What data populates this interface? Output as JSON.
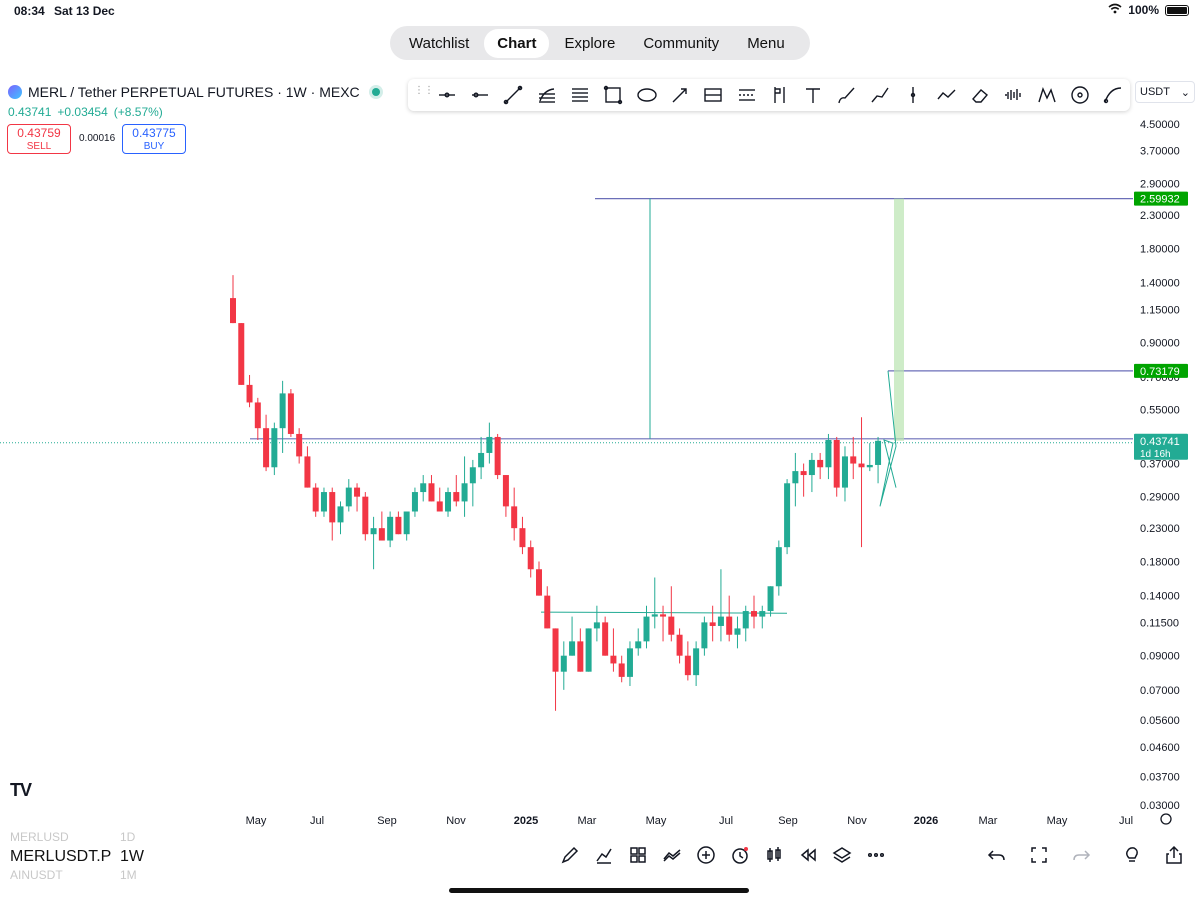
{
  "status_bar": {
    "time": "08:34",
    "date": "Sat 13 Dec",
    "battery": "100%"
  },
  "nav": {
    "items": [
      "Watchlist",
      "Chart",
      "Explore",
      "Community",
      "Menu"
    ],
    "active": "Chart"
  },
  "symbol": {
    "title": "MERL / Tether PERPETUAL FUTURES · 1W · MEXC",
    "last": "0.43741",
    "change": "+0.03454",
    "change_pct": "(+8.57%)",
    "sell_price": "0.43759",
    "sell_label": "SELL",
    "spread": "0.00016",
    "buy_price": "0.43775",
    "buy_label": "BUY"
  },
  "toolbar": {
    "icons": [
      "horizontal-ray-icon",
      "horizontal-line-icon",
      "trend-line-icon",
      "fib-retracement-icon",
      "parallel-channel-icon",
      "rectangle-icon",
      "ellipse-icon",
      "arrow-icon",
      "gann-box-icon",
      "fib-levels-icon",
      "long-short-position-icon",
      "text-icon",
      "brush-icon",
      "path-icon",
      "vertical-line-icon",
      "pattern-icon",
      "eraser-icon",
      "forecast-icon",
      "xabcd-icon",
      "circle-target-icon",
      "curve-icon"
    ]
  },
  "currency": "USDT",
  "colors": {
    "up": "#22ab94",
    "down": "#f23645",
    "accent": "#2962ff",
    "target": "#00a400",
    "hline": "#6b6fb8"
  },
  "chart_data": {
    "type": "candlestick",
    "scale": "log",
    "ylim": [
      0.03,
      4.5
    ],
    "y_ticks": [
      "4.50000",
      "3.70000",
      "2.90000",
      "2.30000",
      "1.80000",
      "1.40000",
      "1.15000",
      "0.90000",
      "0.70000",
      "0.55000",
      "0.37000",
      "0.29000",
      "0.23000",
      "0.18000",
      "0.14000",
      "0.11500",
      "0.09000",
      "0.07000",
      "0.05600",
      "0.04600",
      "0.03700",
      "0.03000"
    ],
    "x_ticks": [
      "May",
      "Jul",
      "Sep",
      "Nov",
      "2025",
      "Mar",
      "May",
      "Jul",
      "Sep",
      "Nov",
      "2026",
      "Mar",
      "May",
      "Jul"
    ],
    "price_labels": [
      {
        "text": "2.59932",
        "value": 2.59932,
        "color": "#00a400"
      },
      {
        "text": "0.73179",
        "value": 0.73179,
        "color": "#00a400"
      },
      {
        "text": "0.43741",
        "value": 0.43741,
        "color": "#22ab94",
        "sub": "1d 16h"
      }
    ],
    "candles": [
      [
        1.25,
        1.48,
        1.04,
        1.04
      ],
      [
        1.04,
        1.04,
        0.66,
        0.66
      ],
      [
        0.66,
        0.71,
        0.56,
        0.58
      ],
      [
        0.58,
        0.6,
        0.44,
        0.48
      ],
      [
        0.48,
        0.53,
        0.35,
        0.36
      ],
      [
        0.36,
        0.5,
        0.34,
        0.48
      ],
      [
        0.48,
        0.68,
        0.4,
        0.62
      ],
      [
        0.62,
        0.64,
        0.45,
        0.46
      ],
      [
        0.46,
        0.48,
        0.37,
        0.39
      ],
      [
        0.39,
        0.42,
        0.31,
        0.31
      ],
      [
        0.31,
        0.32,
        0.25,
        0.26
      ],
      [
        0.26,
        0.31,
        0.25,
        0.3
      ],
      [
        0.3,
        0.31,
        0.21,
        0.24
      ],
      [
        0.24,
        0.28,
        0.22,
        0.27
      ],
      [
        0.27,
        0.33,
        0.26,
        0.31
      ],
      [
        0.31,
        0.32,
        0.26,
        0.29
      ],
      [
        0.29,
        0.3,
        0.21,
        0.22
      ],
      [
        0.22,
        0.25,
        0.17,
        0.23
      ],
      [
        0.23,
        0.26,
        0.21,
        0.21
      ],
      [
        0.21,
        0.26,
        0.2,
        0.25
      ],
      [
        0.25,
        0.26,
        0.22,
        0.22
      ],
      [
        0.22,
        0.26,
        0.21,
        0.26
      ],
      [
        0.26,
        0.31,
        0.25,
        0.3
      ],
      [
        0.3,
        0.34,
        0.28,
        0.32
      ],
      [
        0.32,
        0.34,
        0.28,
        0.28
      ],
      [
        0.28,
        0.31,
        0.26,
        0.26
      ],
      [
        0.26,
        0.31,
        0.25,
        0.3
      ],
      [
        0.3,
        0.34,
        0.27,
        0.28
      ],
      [
        0.28,
        0.39,
        0.25,
        0.32
      ],
      [
        0.32,
        0.38,
        0.27,
        0.36
      ],
      [
        0.36,
        0.45,
        0.33,
        0.4
      ],
      [
        0.4,
        0.5,
        0.37,
        0.45
      ],
      [
        0.45,
        0.46,
        0.33,
        0.34
      ],
      [
        0.34,
        0.34,
        0.25,
        0.27
      ],
      [
        0.27,
        0.31,
        0.21,
        0.23
      ],
      [
        0.23,
        0.25,
        0.19,
        0.2
      ],
      [
        0.2,
        0.21,
        0.16,
        0.17
      ],
      [
        0.17,
        0.18,
        0.14,
        0.14
      ],
      [
        0.14,
        0.15,
        0.11,
        0.11
      ],
      [
        0.11,
        0.11,
        0.06,
        0.08
      ],
      [
        0.08,
        0.1,
        0.07,
        0.09
      ],
      [
        0.09,
        0.12,
        0.09,
        0.1
      ],
      [
        0.1,
        0.11,
        0.08,
        0.08
      ],
      [
        0.08,
        0.11,
        0.08,
        0.11
      ],
      [
        0.11,
        0.13,
        0.1,
        0.115
      ],
      [
        0.115,
        0.12,
        0.09,
        0.09
      ],
      [
        0.09,
        0.11,
        0.08,
        0.085
      ],
      [
        0.085,
        0.09,
        0.074,
        0.077
      ],
      [
        0.077,
        0.1,
        0.072,
        0.095
      ],
      [
        0.095,
        0.11,
        0.09,
        0.1
      ],
      [
        0.1,
        0.13,
        0.095,
        0.12
      ],
      [
        0.12,
        0.16,
        0.11,
        0.122
      ],
      [
        0.122,
        0.13,
        0.1,
        0.12
      ],
      [
        0.12,
        0.15,
        0.1,
        0.105
      ],
      [
        0.105,
        0.11,
        0.085,
        0.09
      ],
      [
        0.09,
        0.1,
        0.075,
        0.078
      ],
      [
        0.078,
        0.1,
        0.072,
        0.095
      ],
      [
        0.095,
        0.12,
        0.09,
        0.115
      ],
      [
        0.115,
        0.13,
        0.1,
        0.112
      ],
      [
        0.112,
        0.17,
        0.1,
        0.12
      ],
      [
        0.12,
        0.14,
        0.1,
        0.105
      ],
      [
        0.105,
        0.12,
        0.095,
        0.11
      ],
      [
        0.11,
        0.13,
        0.1,
        0.125
      ],
      [
        0.125,
        0.14,
        0.11,
        0.12
      ],
      [
        0.12,
        0.13,
        0.11,
        0.125
      ],
      [
        0.125,
        0.15,
        0.12,
        0.15
      ],
      [
        0.15,
        0.21,
        0.14,
        0.2
      ],
      [
        0.2,
        0.33,
        0.19,
        0.32
      ],
      [
        0.32,
        0.4,
        0.27,
        0.35
      ],
      [
        0.35,
        0.37,
        0.29,
        0.34
      ],
      [
        0.34,
        0.4,
        0.3,
        0.38
      ],
      [
        0.38,
        0.4,
        0.33,
        0.36
      ],
      [
        0.36,
        0.46,
        0.33,
        0.44
      ],
      [
        0.44,
        0.45,
        0.29,
        0.31
      ],
      [
        0.31,
        0.42,
        0.28,
        0.39
      ],
      [
        0.39,
        0.45,
        0.33,
        0.37
      ],
      [
        0.37,
        0.52,
        0.2,
        0.36
      ],
      [
        0.36,
        0.43,
        0.35,
        0.3662
      ],
      [
        0.3662,
        0.45,
        0.32,
        0.43741
      ]
    ]
  },
  "bottom": {
    "symbols": [
      "MERLUSD",
      "MERLUSDT.P",
      "AINUSDT"
    ],
    "intervals": [
      "1D",
      "1W",
      "1M"
    ],
    "tools": [
      "brush-icon",
      "indicators-icon",
      "layouts-icon",
      "compare-icon",
      "add-icon",
      "alert-icon",
      "candles-icon",
      "replay-icon",
      "layers-icon",
      "more-icon"
    ],
    "right_tools": [
      "undo-icon",
      "fullscreen-icon",
      "redo-icon",
      "lightbulb-icon",
      "share-icon"
    ]
  }
}
